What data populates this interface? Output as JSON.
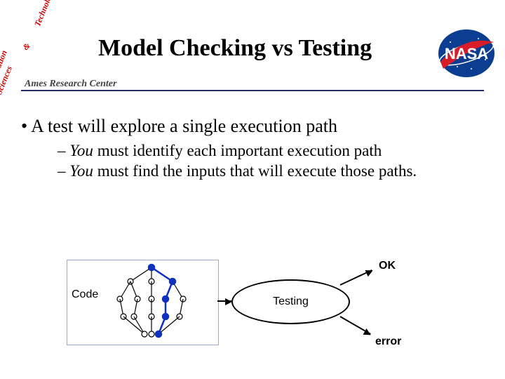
{
  "header": {
    "title": "Model Checking vs Testing",
    "corner_arc_top": "Technology",
    "corner_arc_mid": "&",
    "corner_arc_bottom": "Information Sciences",
    "ames": "Ames Research Center",
    "nasa_alt": "NASA"
  },
  "bullets": {
    "l1": "• A test will explore a single execution path",
    "l2a_pre": "– ",
    "l2a_you": "You",
    "l2a_rest": " must identify each important execution path",
    "l2b_pre": "– ",
    "l2b_you": "You",
    "l2b_rest": " must find the inputs that will execute those paths."
  },
  "diagram": {
    "code": "Code",
    "testing": "Testing",
    "ok": "OK",
    "error": "error"
  }
}
